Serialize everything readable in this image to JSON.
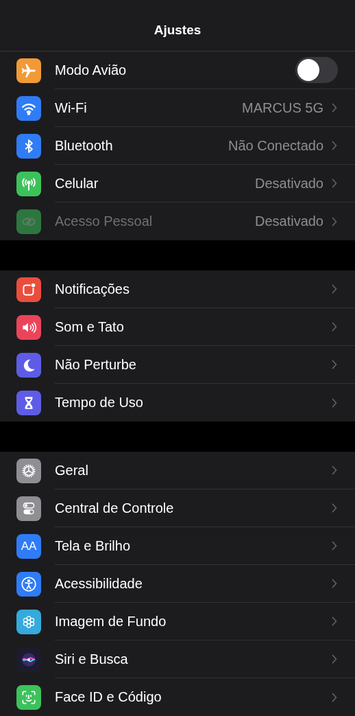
{
  "title": "Ajustes",
  "sections": [
    {
      "rows": [
        {
          "kind": "toggle",
          "label": "Modo Avião",
          "on": false,
          "disabled": false
        },
        {
          "kind": "link",
          "label": "Wi-Fi",
          "value": "MARCUS 5G",
          "disabled": false
        },
        {
          "kind": "link",
          "label": "Bluetooth",
          "value": "Não Conectado",
          "disabled": false
        },
        {
          "kind": "link",
          "label": "Celular",
          "value": "Desativado",
          "disabled": false
        },
        {
          "kind": "link",
          "label": "Acesso Pessoal",
          "value": "Desativado",
          "disabled": true
        }
      ]
    },
    {
      "rows": [
        {
          "kind": "link",
          "label": "Notificações",
          "disabled": false
        },
        {
          "kind": "link",
          "label": "Som e Tato",
          "disabled": false
        },
        {
          "kind": "link",
          "label": "Não Perturbe",
          "disabled": false
        },
        {
          "kind": "link",
          "label": "Tempo de Uso",
          "disabled": false
        }
      ]
    },
    {
      "rows": [
        {
          "kind": "link",
          "label": "Geral",
          "disabled": false
        },
        {
          "kind": "link",
          "label": "Central de Controle",
          "disabled": false
        },
        {
          "kind": "link",
          "icon_text": "AA",
          "label": "Tela e Brilho",
          "disabled": false
        },
        {
          "kind": "link",
          "label": "Acessibilidade",
          "disabled": false
        },
        {
          "kind": "link",
          "label": "Imagem de Fundo",
          "disabled": false
        },
        {
          "kind": "link",
          "label": "Siri e Busca",
          "disabled": false
        },
        {
          "kind": "link",
          "label": "Face ID e Código",
          "disabled": false
        }
      ]
    }
  ]
}
